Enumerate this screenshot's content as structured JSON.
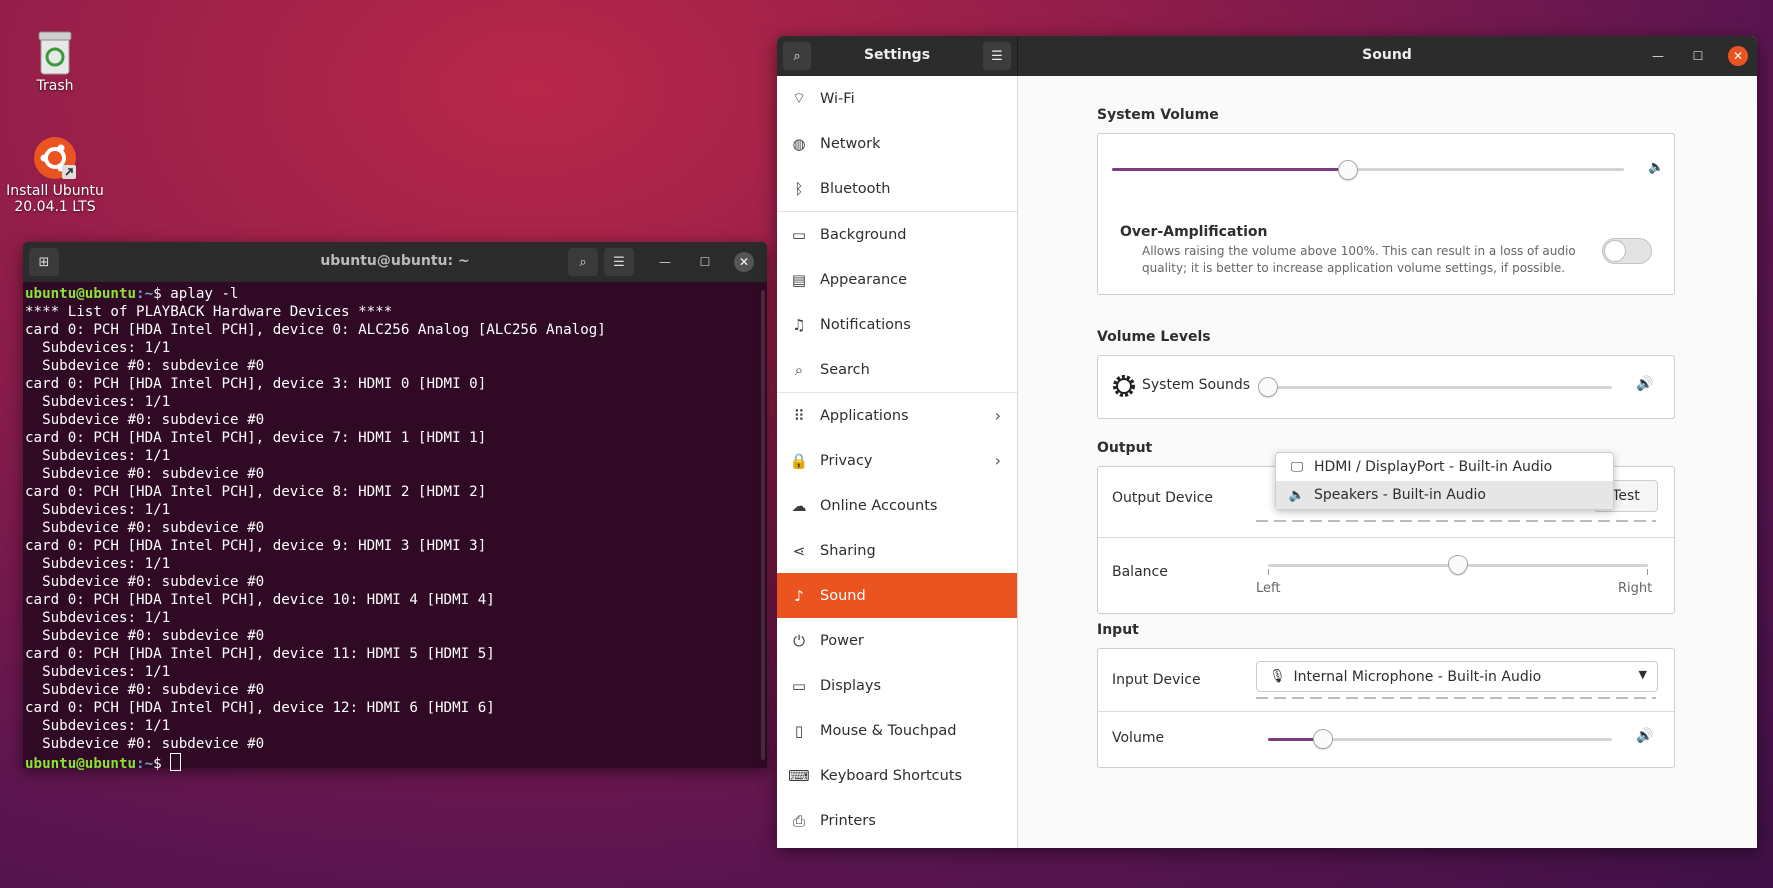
{
  "desktop": {
    "icons": [
      {
        "label": "Trash",
        "name": "trash-icon"
      },
      {
        "label_line1": "Install Ubuntu",
        "label_line2": "20.04.1 LTS",
        "name": "install-ubuntu-icon"
      }
    ]
  },
  "terminal": {
    "title": "ubuntu@ubuntu: ~",
    "prompt_user": "ubuntu@ubuntu",
    "prompt_path": ":~",
    "prompt_symbol": "$ ",
    "command": "aplay -l",
    "output": [
      "**** List of PLAYBACK Hardware Devices ****",
      "card 0: PCH [HDA Intel PCH], device 0: ALC256 Analog [ALC256 Analog]",
      "  Subdevices: 1/1",
      "  Subdevice #0: subdevice #0",
      "card 0: PCH [HDA Intel PCH], device 3: HDMI 0 [HDMI 0]",
      "  Subdevices: 1/1",
      "  Subdevice #0: subdevice #0",
      "card 0: PCH [HDA Intel PCH], device 7: HDMI 1 [HDMI 1]",
      "  Subdevices: 1/1",
      "  Subdevice #0: subdevice #0",
      "card 0: PCH [HDA Intel PCH], device 8: HDMI 2 [HDMI 2]",
      "  Subdevices: 1/1",
      "  Subdevice #0: subdevice #0",
      "card 0: PCH [HDA Intel PCH], device 9: HDMI 3 [HDMI 3]",
      "  Subdevices: 1/1",
      "  Subdevice #0: subdevice #0",
      "card 0: PCH [HDA Intel PCH], device 10: HDMI 4 [HDMI 4]",
      "  Subdevices: 1/1",
      "  Subdevice #0: subdevice #0",
      "card 0: PCH [HDA Intel PCH], device 11: HDMI 5 [HDMI 5]",
      "  Subdevices: 1/1",
      "  Subdevice #0: subdevice #0",
      "card 0: PCH [HDA Intel PCH], device 12: HDMI 6 [HDMI 6]",
      "  Subdevices: 1/1",
      "  Subdevice #0: subdevice #0"
    ]
  },
  "settings": {
    "sidebar_title": "Settings",
    "panel_title": "Sound",
    "sidebar": [
      {
        "label": "Wi-Fi",
        "icon": "wifi-icon",
        "glyph": "⌔"
      },
      {
        "label": "Network",
        "icon": "network-icon",
        "glyph": "◍"
      },
      {
        "label": "Bluetooth",
        "icon": "bluetooth-icon",
        "glyph": "ᛒ"
      },
      {
        "label": "Background",
        "icon": "background-icon",
        "glyph": "▭"
      },
      {
        "label": "Appearance",
        "icon": "appearance-icon",
        "glyph": "▤"
      },
      {
        "label": "Notifications",
        "icon": "notifications-icon",
        "glyph": "♫"
      },
      {
        "label": "Search",
        "icon": "search-icon",
        "glyph": "⌕"
      },
      {
        "label": "Applications",
        "icon": "applications-icon",
        "glyph": "⠿"
      },
      {
        "label": "Privacy",
        "icon": "privacy-icon",
        "glyph": "🔒"
      },
      {
        "label": "Online Accounts",
        "icon": "cloud-icon",
        "glyph": "☁"
      },
      {
        "label": "Sharing",
        "icon": "sharing-icon",
        "glyph": "⋖"
      },
      {
        "label": "Sound",
        "icon": "music-note-icon",
        "glyph": "♪"
      },
      {
        "label": "Power",
        "icon": "power-icon",
        "glyph": "⏻"
      },
      {
        "label": "Displays",
        "icon": "displays-icon",
        "glyph": "▭"
      },
      {
        "label": "Mouse & Touchpad",
        "icon": "mouse-icon",
        "glyph": "▯"
      },
      {
        "label": "Keyboard Shortcuts",
        "icon": "keyboard-icon",
        "glyph": "⌨"
      },
      {
        "label": "Printers",
        "icon": "printer-icon",
        "glyph": "⎙"
      }
    ],
    "sound": {
      "system_volume_title": "System Volume",
      "system_volume_level": 0.46,
      "over_amp_title": "Over-Amplification",
      "over_amp_desc_1": "Allows raising the volume above 100%. This can result in a loss of audio",
      "over_amp_desc_2": "quality; it is better to increase application volume settings, if possible.",
      "over_amp_enabled": false,
      "volume_levels_title": "Volume Levels",
      "system_sounds_label": "System Sounds",
      "system_sounds_level": 0.0,
      "output_title": "Output",
      "output_device_label": "Output Device",
      "output_options": [
        {
          "label": "HDMI / DisplayPort - Built-in Audio",
          "icon": "monitor-icon",
          "glyph": "🖵",
          "selected": false
        },
        {
          "label": "Speakers - Built-in Audio",
          "icon": "speaker-icon",
          "glyph": "🔈",
          "selected": true
        }
      ],
      "test_label": "Test",
      "balance_label": "Balance",
      "balance_left": "Left",
      "balance_right": "Right",
      "balance_level": 0.5,
      "input_title": "Input",
      "input_device_label": "Input Device",
      "input_device_value": "Internal Microphone - Built-in Audio",
      "input_volume_label": "Volume",
      "input_volume_level": 0.16
    }
  }
}
